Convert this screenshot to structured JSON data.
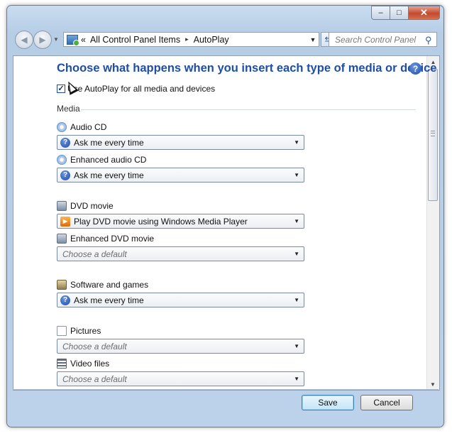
{
  "window": {
    "minimize": "–",
    "maximize": "□",
    "close": "✕"
  },
  "nav": {
    "back_icon": "back-arrow",
    "forward_icon": "forward-arrow",
    "breadcrumb_prefix": "«",
    "breadcrumb": [
      "All Control Panel Items",
      "AutoPlay"
    ],
    "breadcrumb_separator": "▸",
    "search_placeholder": "Search Control Panel"
  },
  "main": {
    "title": "Choose what happens when you insert each type of media or device",
    "help": "?",
    "autoplay_label": "Use AutoPlay for all media and devices",
    "autoplay_checked": true,
    "section_media": "Media",
    "items": [
      {
        "label": "Audio CD",
        "icon": "audio-cd-icon",
        "value": "Ask me every time",
        "value_icon": "question-icon"
      },
      {
        "label": "Enhanced audio CD",
        "icon": "audio-cd-icon",
        "value": "Ask me every time",
        "value_icon": "question-icon"
      },
      {
        "label": "DVD movie",
        "icon": "dvd-icon",
        "value": "Play DVD movie using Windows Media Player",
        "value_icon": "media-player-icon"
      },
      {
        "label": "Enhanced DVD movie",
        "icon": "dvd-icon",
        "value": "Choose a default",
        "value_icon": ""
      },
      {
        "label": "Software and games",
        "icon": "software-icon",
        "value": "Ask me every time",
        "value_icon": "question-icon"
      },
      {
        "label": "Pictures",
        "icon": "pictures-icon",
        "value": "Choose a default",
        "value_icon": ""
      },
      {
        "label": "Video files",
        "icon": "video-icon",
        "value": "Choose a default",
        "value_icon": ""
      }
    ]
  },
  "footer": {
    "save": "Save",
    "cancel": "Cancel"
  }
}
